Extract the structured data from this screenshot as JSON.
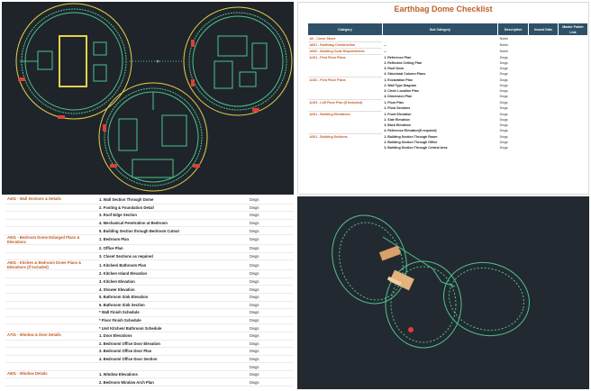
{
  "checklist": {
    "title": "Earthbag Dome Checklist",
    "headers": [
      "Category",
      "Sub Category",
      "Description",
      "Issued Date",
      "Master Folder Link"
    ],
    "rows": [
      {
        "cat": "A0 - Cover Sheet",
        "sub": "",
        "desc": "Notes"
      },
      {
        "cat": "A001 - Earthbag Construction",
        "sub": "--",
        "desc": "Notes"
      },
      {
        "cat": "A002 - Building Code Requirements",
        "sub": "--",
        "desc": "Notes"
      },
      {
        "cat": "A101 - First Floor Plans",
        "sub": "1. Reference Plan",
        "desc": "Dwgs"
      },
      {
        "cat": "",
        "sub": "2. Reflected Ceiling Plan",
        "desc": "Dwgs"
      },
      {
        "cat": "",
        "sub": "3. Roof Deck",
        "desc": "Dwgs"
      },
      {
        "cat": "",
        "sub": "4. Structural Column Plans",
        "desc": "Dwgs"
      },
      {
        "cat": "A102 - First Floor Plans",
        "sub": "1. Excavation Plan",
        "desc": "Dwgs"
      },
      {
        "cat": "",
        "sub": "2. Wall Type Diagram",
        "desc": "Dwgs"
      },
      {
        "cat": "",
        "sub": "3. Circle Location Plan",
        "desc": "Dwgs"
      },
      {
        "cat": "",
        "sub": "4. Dimension Plan",
        "desc": "Dwgs"
      },
      {
        "cat": "A103 - Loft Floor Plan (If Included)",
        "sub": "1. Floor Plan",
        "desc": "Dwgs"
      },
      {
        "cat": "",
        "sub": "2. Floor Sections",
        "desc": "Dwgs"
      },
      {
        "cat": "A201 - Building Elevations",
        "sub": "1. Front Elevation",
        "desc": "Dwgs"
      },
      {
        "cat": "",
        "sub": "2. Side Elevation",
        "desc": "Dwgs"
      },
      {
        "cat": "",
        "sub": "3. Back Elevation",
        "desc": "Dwgs"
      },
      {
        "cat": "",
        "sub": "4. Reference Elevation(If required)",
        "desc": "Dwgs"
      },
      {
        "cat": "A301 - Building Sections",
        "sub": "1. Building Section Through Room",
        "desc": "Dwgs"
      },
      {
        "cat": "",
        "sub": "2. Building Section Through Office",
        "desc": "Dwgs"
      },
      {
        "cat": "",
        "sub": "3. Building Section Through Central Area",
        "desc": "Dwgs"
      }
    ]
  },
  "details_list": {
    "rows": [
      {
        "cat": "A401 - Wall Sections & Details",
        "sub": "1. Wall Section Through Dome",
        "desc": "Dwgs"
      },
      {
        "cat": "",
        "sub": "2. Footing & Foundation Detail",
        "desc": "Dwgs"
      },
      {
        "cat": "",
        "sub": "3. Roof Edge Section",
        "desc": "Dwgs"
      },
      {
        "cat": "",
        "sub": "4. Mechanical Penetration at Bedroom",
        "desc": "Dwgs"
      },
      {
        "cat": "",
        "sub": "5. Building Section through Bedroom Cutout",
        "desc": "Dwgs"
      },
      {
        "cat": "A501 - Bedroom Dome Enlarged Plans & Elevations",
        "sub": "1. Bedroom Plan",
        "desc": "Dwgs"
      },
      {
        "cat": "",
        "sub": "2. Office Plan",
        "desc": "Dwgs"
      },
      {
        "cat": "",
        "sub": "3. Closet Sections as required",
        "desc": "Dwgs"
      },
      {
        "cat": "A601 - Kitchen & Bedroom Dome Plans & Elevations (If Included)",
        "sub": "1. Kitchen/ Bathroom Plan",
        "desc": "Dwgs"
      },
      {
        "cat": "",
        "sub": "2. Kitchen Island Elevation",
        "desc": "Dwgs"
      },
      {
        "cat": "",
        "sub": "3. Kitchen Elevation",
        "desc": "Dwgs"
      },
      {
        "cat": "",
        "sub": "4. Shower Elevation",
        "desc": "Dwgs"
      },
      {
        "cat": "",
        "sub": "5. Bathroom Sink Elevation",
        "desc": "Dwgs"
      },
      {
        "cat": "",
        "sub": "6. Bathroom Sink Section",
        "desc": "Dwgs"
      },
      {
        "cat": "",
        "sub": "* Wall Finish Schedule",
        "desc": "Dwgs"
      },
      {
        "cat": "",
        "sub": "* Floor Finish Schedule",
        "desc": "Dwgs"
      },
      {
        "cat": "",
        "sub": "* Unit Kitchen/ Bathroom Schedule",
        "desc": "Dwgs"
      },
      {
        "cat": "A701 - Window & Door Details",
        "sub": "1. Door Elevations",
        "desc": "Dwgs"
      },
      {
        "cat": "",
        "sub": "2. Bedroom/ Office Door Elevation",
        "desc": "Dwgs"
      },
      {
        "cat": "",
        "sub": "3. Bedroom/ Office Door Plan",
        "desc": "Dwgs"
      },
      {
        "cat": "",
        "sub": "4. Bedroom/ Office Door Section",
        "desc": "Dwgs"
      },
      {
        "cat": "",
        "sub": "",
        "desc": "Dwgs"
      },
      {
        "cat": "A801 - Window Details",
        "sub": "1. Window Elevations",
        "desc": "Dwgs"
      },
      {
        "cat": "",
        "sub": "2. Bedroom Window Arch Plan",
        "desc": "Dwgs"
      }
    ]
  },
  "colors": {
    "cad_bg": "#1f242a",
    "cad_line": "#4ec28e",
    "cad_wall": "#e4d34a",
    "cad_accent": "#d9413a",
    "header_bg": "#2f5168",
    "category_text": "#c25a22"
  }
}
